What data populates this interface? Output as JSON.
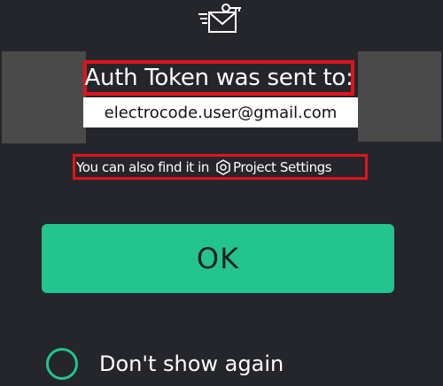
{
  "dialog": {
    "title": "Auth Token was sent to:",
    "email": "electrocode.user@gmail.com",
    "hint_prefix": "You can also find it in",
    "hint_settings": "Project Settings",
    "ok_label": "OK",
    "dont_show_label": "Don't show again"
  },
  "icons": {
    "top": "mail-key-icon",
    "settings": "hexagon-settings-icon",
    "checkbox": "radio-circle"
  },
  "colors": {
    "background": "#25262b",
    "accent": "#23c48e",
    "highlight_border": "#e0141c",
    "side_blocks": "#4a4a4a",
    "email_banner": "#ffffff"
  }
}
